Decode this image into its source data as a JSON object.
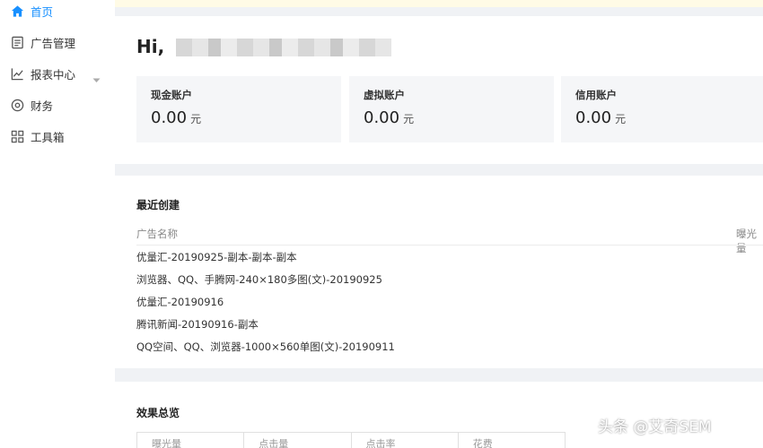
{
  "sidebar": {
    "items": [
      {
        "label": "首页",
        "icon": "home-icon",
        "active": true
      },
      {
        "label": "广告管理",
        "icon": "document-icon"
      },
      {
        "label": "报表中心",
        "icon": "line-chart-icon",
        "expandable": true
      },
      {
        "label": "财务",
        "icon": "target-icon"
      },
      {
        "label": "工具箱",
        "icon": "grid-icon"
      }
    ]
  },
  "overview": {
    "greeting": "Hi,",
    "accounts": [
      {
        "name": "现金账户",
        "amount": "0.00",
        "unit": "元"
      },
      {
        "name": "虚拟账户",
        "amount": "0.00",
        "unit": "元"
      },
      {
        "name": "信用账户",
        "amount": "0.00",
        "unit": "元"
      }
    ]
  },
  "recent": {
    "title": "最近创建",
    "columns": [
      "广告名称",
      "曝光量"
    ],
    "rows": [
      "优量汇-20190925-副本-副本-副本",
      "浏览器、QQ、手腾网-240×180多图(文)-20190925",
      "优量汇-20190916",
      "腾讯新闻-20190916-副本",
      "QQ空间、QQ、浏览器-1000×560单图(文)-20190911"
    ]
  },
  "summary": {
    "title": "效果总览",
    "columns": [
      "曝光量",
      "点击量",
      "点击率",
      "花费"
    ]
  },
  "watermark": "头条 @艾奇SEM",
  "colors": {
    "accent": "#1890ff",
    "background": "#f0f2f5",
    "notice": "#fffbe6"
  }
}
